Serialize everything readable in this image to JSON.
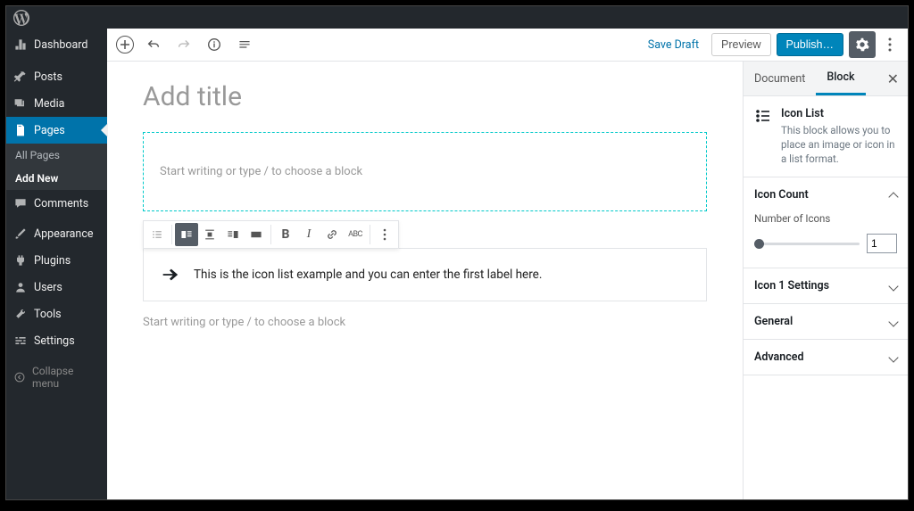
{
  "adminbar": {},
  "sidebar": {
    "items": [
      {
        "label": "Dashboard"
      },
      {
        "label": "Posts"
      },
      {
        "label": "Media"
      },
      {
        "label": "Pages"
      },
      {
        "label": "Comments"
      },
      {
        "label": "Appearance"
      },
      {
        "label": "Plugins"
      },
      {
        "label": "Users"
      },
      {
        "label": "Tools"
      },
      {
        "label": "Settings"
      }
    ],
    "sub": {
      "all": "All Pages",
      "add": "Add New"
    },
    "collapse": "Collapse menu"
  },
  "topbar": {
    "save_draft": "Save Draft",
    "preview": "Preview",
    "publish": "Publish…"
  },
  "canvas": {
    "title_placeholder": "Add title",
    "block_placeholder": "Start writing or type / to choose a block",
    "icon_list_text": "This is the icon list example and you can enter the first label here.",
    "below_placeholder": "Start writing or type / to choose a block"
  },
  "inspector": {
    "tabs": {
      "document": "Document",
      "block": "Block"
    },
    "block_info": {
      "title": "Icon List",
      "desc": "This block allows you to place an image or icon in a list format."
    },
    "panels": {
      "icon_count": {
        "title": "Icon Count",
        "label": "Number of Icons",
        "value": "1"
      },
      "icon1": {
        "title": "Icon 1 Settings"
      },
      "general": {
        "title": "General"
      },
      "advanced": {
        "title": "Advanced"
      }
    }
  }
}
